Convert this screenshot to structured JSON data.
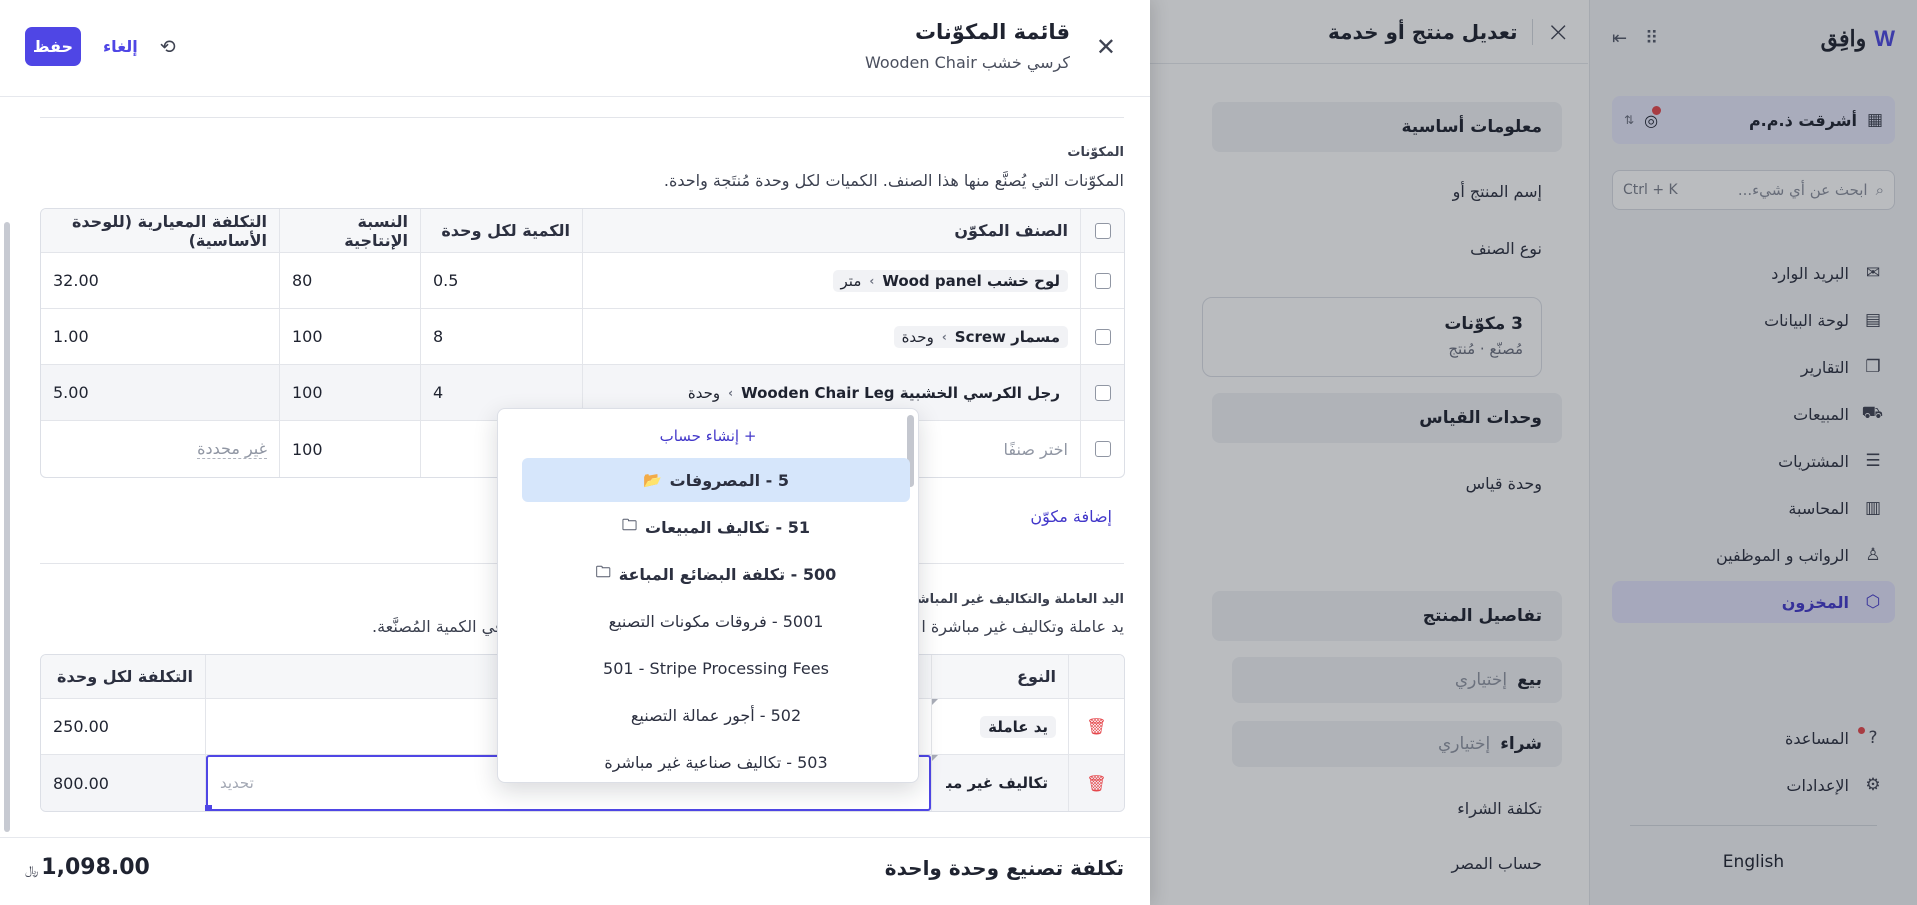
{
  "sidebar": {
    "brand": "وافِق",
    "company": "أشرقت ذ.م.م",
    "search_placeholder": "ابحث عن أي شيء...",
    "search_shortcut": "Ctrl + K",
    "nav": [
      {
        "label": "البريد الوارد",
        "icon": "inbox-icon"
      },
      {
        "label": "لوحة البيانات",
        "icon": "dashboard-icon"
      },
      {
        "label": "التقارير",
        "icon": "reports-icon"
      },
      {
        "label": "المبيعات",
        "icon": "cart-icon"
      },
      {
        "label": "المشتريات",
        "icon": "receipt-icon"
      },
      {
        "label": "المحاسبة",
        "icon": "ledger-icon"
      },
      {
        "label": "الرواتب و الموظفين",
        "icon": "users-icon"
      },
      {
        "label": "المخزون",
        "icon": "box-icon",
        "active": true
      }
    ],
    "help": "المساعدة",
    "settings": "الإعدادات",
    "language": "English"
  },
  "middle": {
    "title": "تعديل منتج أو خدمة",
    "basic_info": "معلومات أساسية",
    "name_label": "إسم المنتج أو",
    "type_label": "نوع الصنف",
    "components_card_title": "3 مكوّنات",
    "components_card_sub": "مُصنّع · مُنتج",
    "units_head": "وحدات القياس",
    "unit_label": "وحدة قياس",
    "details_head": "تفاصيل المنتج",
    "sell_label": "بيع",
    "buy_label": "شراء",
    "optional": "إختياري",
    "purchase_cost": "تكلفة الشراء",
    "expense_account": "حساب المصر"
  },
  "panel": {
    "title": "قائمة المكوّنات",
    "subtitle": "كرسي خشب Wooden Chair",
    "save": "حفظ",
    "cancel": "إلغاء"
  },
  "components": {
    "caption": "المكوّنات",
    "description": "المكوّنات التي يُصنَّع منها هذا الصنف. الكميات لكل وحدة مُنتَجة واحدة.",
    "headers": {
      "item": "الصنف المكوّن",
      "qty": "الكمية لكل وحدة",
      "yield": "النسبة الإنتاجية",
      "cost": "التكلفة المعيارية (للوحدة الأساسية)"
    },
    "rows": [
      {
        "item": "لوح خشب Wood panel",
        "unit": "متر",
        "qty": "0.5",
        "yield": "80",
        "cost": "32.00"
      },
      {
        "item": "مسمار Screw",
        "unit": "وحدة",
        "qty": "8",
        "yield": "100",
        "cost": "1.00"
      },
      {
        "item": "رجل الكرسي الخشبية Wooden Chair Leg",
        "unit": "وحدة",
        "qty": "4",
        "yield": "100",
        "cost": "5.00"
      }
    ],
    "new_row": {
      "placeholder": "اختر صنفًا",
      "yield": "100",
      "cost": "غير محددة"
    },
    "add": "إضافة مكوّن"
  },
  "labor": {
    "caption": "اليد العاملة والتكاليف غير المباشرة",
    "description_start": "يد عاملة وتكاليف غير مباشرة ا",
    "description_end": "في الكمية المُصنَّعة.",
    "headers": {
      "type": "النوع",
      "cost": "التكلفة لكل وحدة"
    },
    "rows": [
      {
        "type": "يد عاملة",
        "cost": "250.00"
      },
      {
        "type": "تكاليف غير مباشرة",
        "cost": "800.00",
        "account_placeholder": "تحديد"
      }
    ]
  },
  "footer": {
    "label": "تكلفة تصنيع وحدة واحدة",
    "total": "1,098.00",
    "currency": "﷼"
  },
  "dropdown": {
    "create": "+ إنشاء حساب",
    "options": [
      {
        "label": "5 - المصروفات",
        "folder": true,
        "selected": true
      },
      {
        "label": "51 - تكاليف المبيعات",
        "folder": true
      },
      {
        "label": "500 - تكلفة البضائع المباعة",
        "folder": true
      },
      {
        "label": "5001 - فروقات مكونات التصنيع",
        "folder": false
      },
      {
        "label": "501 - Stripe Processing Fees",
        "folder": false
      },
      {
        "label": "502 - أجور عمالة التصنيع",
        "folder": false
      },
      {
        "label": "503 - تكاليف صناعية غير مباشرة",
        "folder": false
      }
    ]
  }
}
